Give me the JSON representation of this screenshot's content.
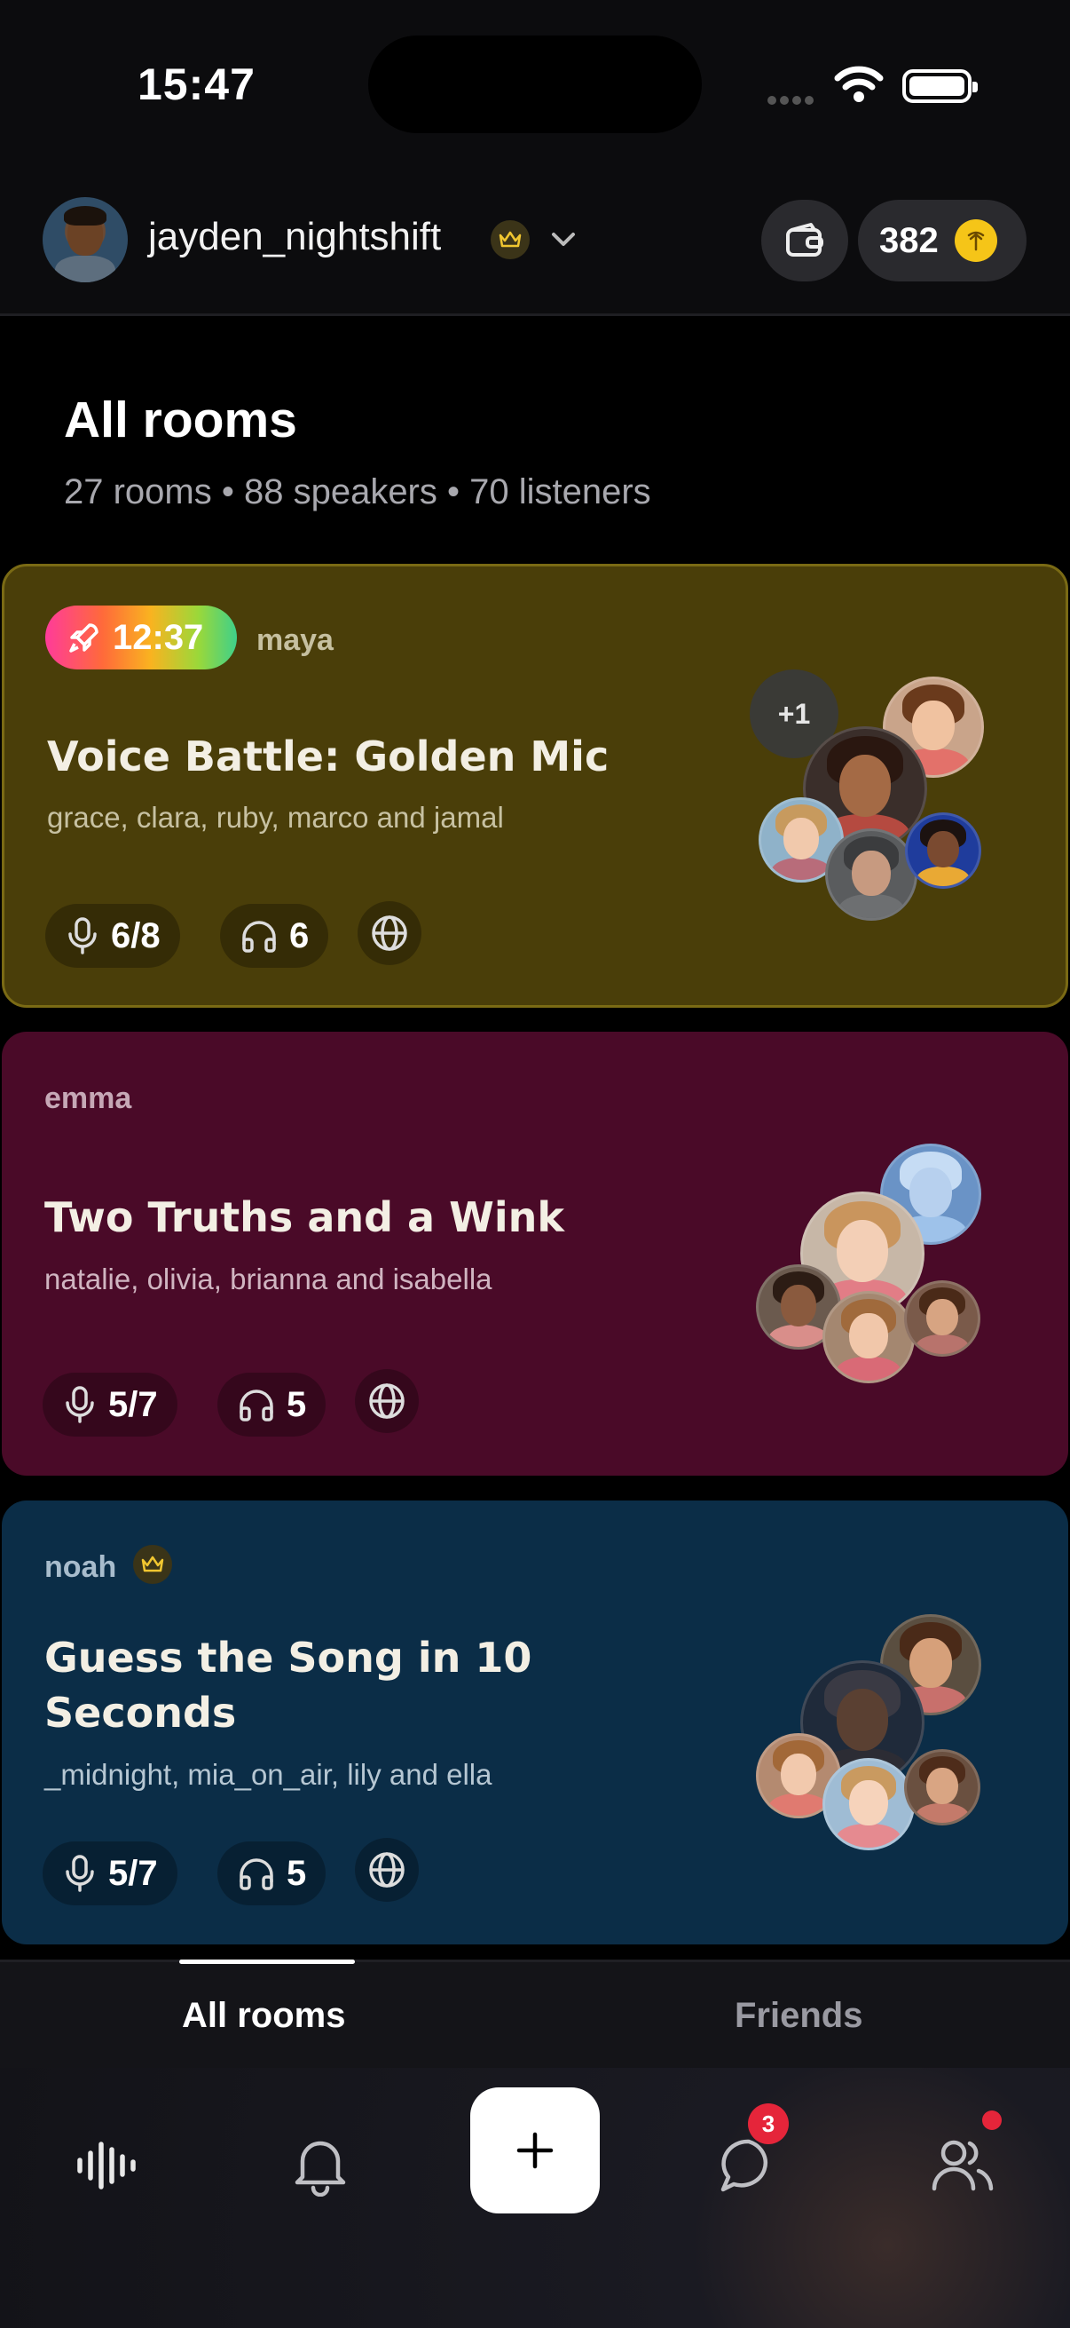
{
  "status_bar": {
    "time": "15:47"
  },
  "header": {
    "username": "jayden_nightshift",
    "coins": "382"
  },
  "page": {
    "title": "All rooms",
    "subtitle": "27 rooms • 88 speakers • 70 listeners"
  },
  "rooms": [
    {
      "timer": "12:37",
      "host": "maya",
      "title": "Voice Battle: Golden Mic",
      "members": "grace, clara, ruby, marco and jamal",
      "speakers": "6/8",
      "listeners": "6",
      "extra": "+1",
      "bg": "#4a3e09"
    },
    {
      "host": "emma",
      "title": "Two Truths and a Wink",
      "members": "natalie, olivia, brianna and isabella",
      "speakers": "5/7",
      "listeners": "5",
      "bg": "#4a0a28"
    },
    {
      "host": "noah",
      "title": "Guess the Song in 10 Seconds",
      "members": "_midnight, mia_on_air, lily and ella",
      "speakers": "5/7",
      "listeners": "5",
      "bg": "#0b2d47"
    }
  ],
  "tabs": [
    {
      "label": "All rooms"
    },
    {
      "label": "Friends"
    }
  ],
  "nav": {
    "messages_badge": "3"
  },
  "icons": [
    "wifi-icon",
    "battery-icon",
    "crown-icon",
    "chevron-down-icon",
    "wallet-icon",
    "coin-icon",
    "rocket-icon",
    "mic-icon",
    "headphones-icon",
    "globe-icon",
    "waveform-icon",
    "bell-icon",
    "plus-icon",
    "chat-icon",
    "people-icon"
  ]
}
